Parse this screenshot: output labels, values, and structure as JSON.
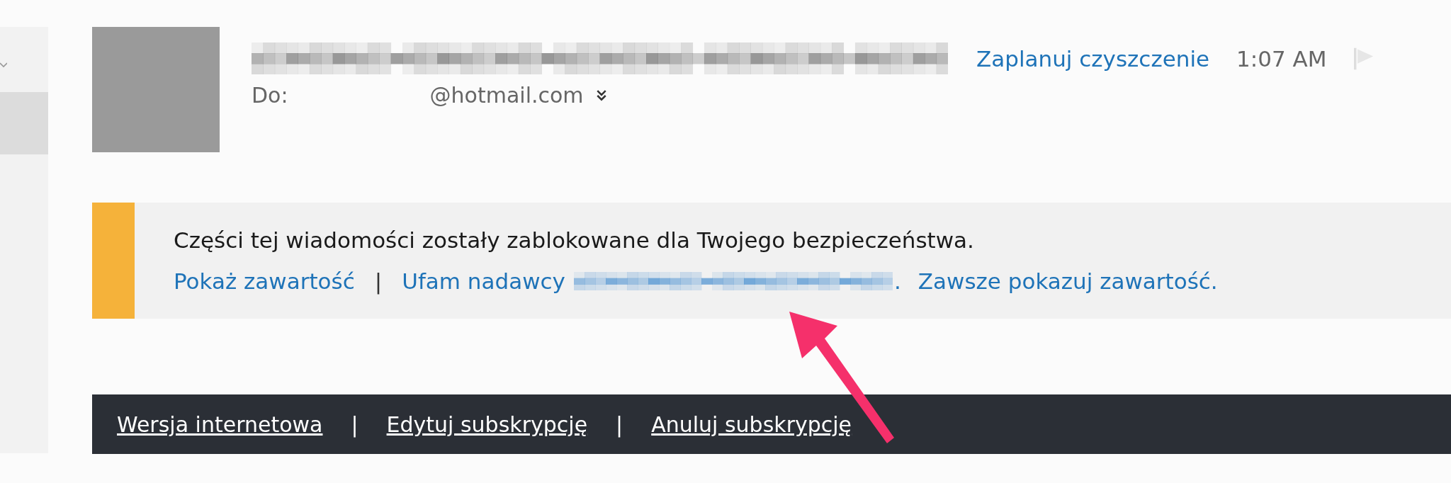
{
  "header": {
    "schedule_link": "Zaplanuj czyszczenie",
    "time": "1:07 AM",
    "to_label": "Do:",
    "to_address": "@hotmail.com"
  },
  "banner": {
    "message": "Części tej wiadomości zostały zablokowane dla Twojego bezpieczeństwa.",
    "show_link": "Pokaż zawartość",
    "separator": "|",
    "trust_link": "Ufam nadawcy",
    "after_sender": ".",
    "always_link": "Zawsze pokazuj zawartość."
  },
  "footer": {
    "links": [
      "Wersja internetowa",
      "Edytuj subskrypcję",
      "Anuluj subskrypcję"
    ],
    "separators": [
      "|",
      "|"
    ]
  }
}
